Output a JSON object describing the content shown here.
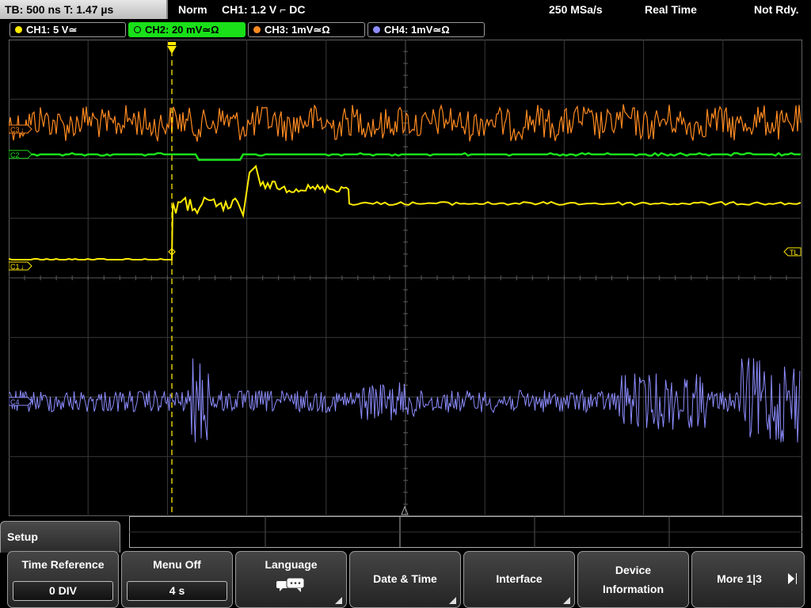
{
  "status": {
    "timebase": "TB: 500 ns   T: 1.47 µs",
    "mode": "Norm",
    "trigger": "CH1: 1.2 V ⌐ DC",
    "sample_rate": "250 MSa/s",
    "acquisition": "Real Time",
    "state": "Not Rdy."
  },
  "channels": [
    {
      "label": "CH1: 5 V≃",
      "color": "#ffea00",
      "active": false
    },
    {
      "label": "CH2: 20 mV≃Ω",
      "color": "#19e019",
      "active": true
    },
    {
      "label": "CH3: 1mV≃Ω",
      "color": "#ff8a20",
      "active": false
    },
    {
      "label": "CH4: 1mV≃Ω",
      "color": "#8c8cff",
      "active": false
    }
  ],
  "markers": {
    "c1": "C1",
    "c2": "C2",
    "c3": "C3",
    "c4": "C4",
    "trigger_level": "TL"
  },
  "menu": {
    "title": "Setup",
    "keys": {
      "time_reference": {
        "label": "Time Reference",
        "value": "0 DIV"
      },
      "menu_off": {
        "label": "Menu Off",
        "value": "4 s"
      },
      "language": {
        "label": "Language",
        "icon": "speech-bubbles-icon"
      },
      "date_time": {
        "label": "Date & Time"
      },
      "interface": {
        "label": "Interface"
      },
      "device_information": {
        "line1": "Device",
        "line2": "Information"
      },
      "more": {
        "label": "More 1|3"
      }
    }
  },
  "colors": {
    "ch1": "#ffea00",
    "ch2": "#19e019",
    "ch3": "#ff8a20",
    "ch4": "#8c8cff",
    "grid": "#4a4a4a"
  }
}
